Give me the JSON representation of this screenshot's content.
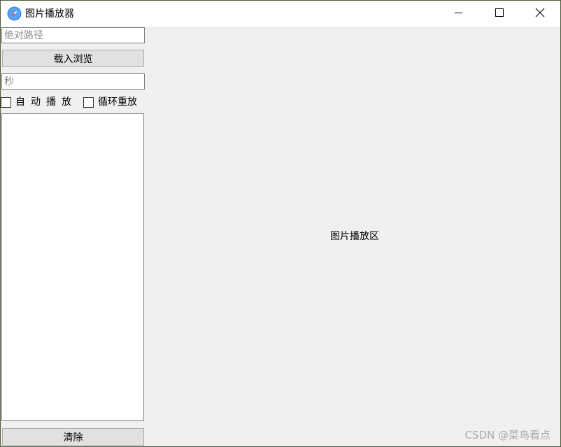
{
  "window": {
    "title": "图片播放器",
    "icon": "compass-icon",
    "controls": [
      "minimize-icon",
      "maximize-icon",
      "close-icon"
    ]
  },
  "left_panel": {
    "path_input": {
      "placeholder": "绝对路径",
      "value": ""
    },
    "load_button": "载入浏览",
    "seconds_input": {
      "placeholder": "秒",
      "value": ""
    },
    "auto_play": {
      "label": "自动播放",
      "checked": false
    },
    "loop_replay": {
      "label": "循环重放",
      "checked": false
    },
    "image_list": [],
    "clear_button": "清除"
  },
  "display": {
    "placeholder_text": "图片播放区"
  },
  "watermark": "CSDN @菜鸟看点",
  "colors": {
    "titlebar_bg": "#ffffff",
    "window_bg": "#f0f0f0",
    "button_bg": "#e1e1e1",
    "icon_accent": "#3b8be8"
  }
}
